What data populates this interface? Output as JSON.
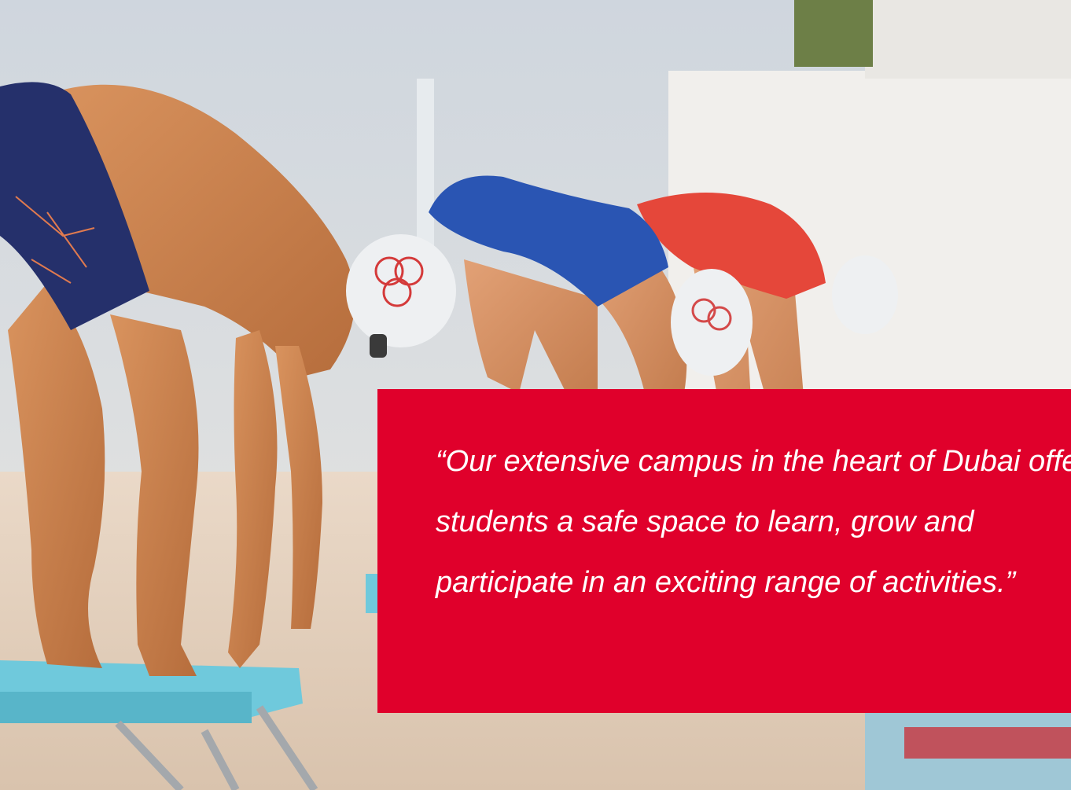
{
  "quote": {
    "text": "“Our extensive campus in the heart of Dubai offers students a safe space to learn, grow and participate in an exciting range of activities.”"
  },
  "colors": {
    "quote_background": "#e0002b",
    "quote_text": "#ffffff"
  }
}
